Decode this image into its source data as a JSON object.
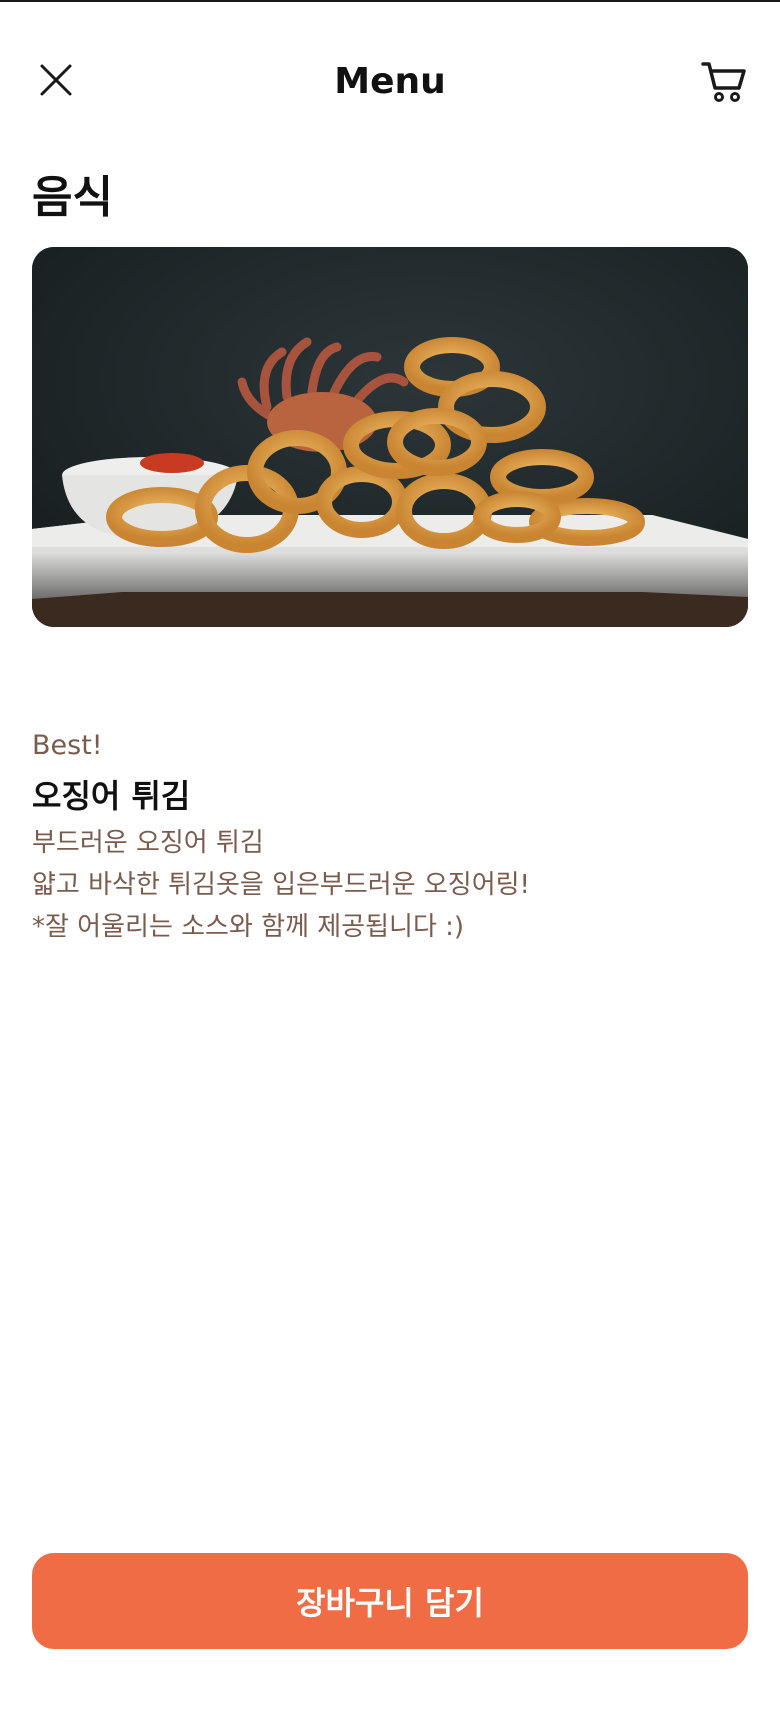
{
  "header": {
    "title": "Menu",
    "close_icon": "close-icon",
    "cart_icon": "cart-icon"
  },
  "section": {
    "title": "음식"
  },
  "item": {
    "image_icon": "fried-calamari-photo",
    "tag": "Best!",
    "name": "오징어 튀김",
    "description_lines": [
      "부드러운 오징어 튀김",
      "얇고 바삭한 튀김옷을 입은부드러운 오징어링!",
      "*잘 어울리는 소스와 함께 제공됩니다 :)"
    ]
  },
  "footer": {
    "add_to_cart_label": "장바구니 담기"
  },
  "colors": {
    "accent": "#ef6c45",
    "description_text": "#7a5c4f",
    "title_text": "#111111"
  }
}
